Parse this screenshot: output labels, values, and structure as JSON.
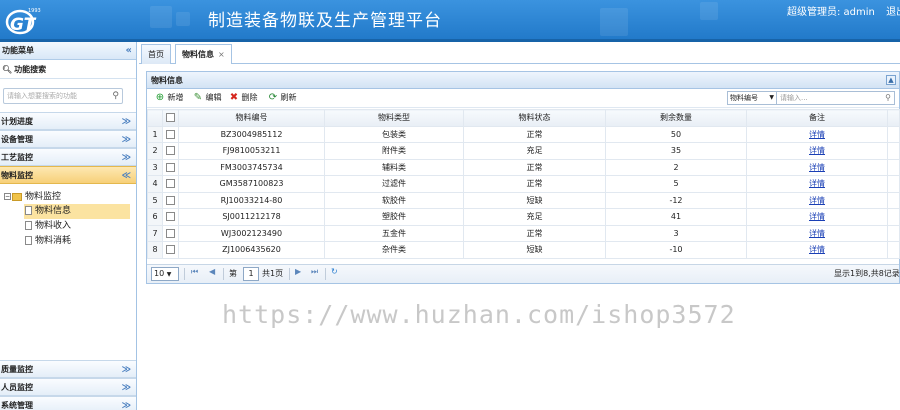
{
  "header": {
    "title": "制造装备物联及生产管理平台",
    "user_label": "超级管理员: admin",
    "logout": "退出",
    "logo_small": "1993",
    "logo_text": "GT"
  },
  "sidebar": {
    "title": "功能菜单",
    "collapse": "«",
    "search_title": "功能搜索",
    "search_placeholder": "请输入想要搜索的功能",
    "sections": [
      {
        "label": "计划进度",
        "chev": "≫"
      },
      {
        "label": "设备管理",
        "chev": "≫"
      },
      {
        "label": "工艺监控",
        "chev": "≫"
      },
      {
        "label": "物料监控",
        "chev": "≪"
      },
      {
        "label": "质量监控",
        "chev": "≫"
      },
      {
        "label": "人员监控",
        "chev": "≫"
      },
      {
        "label": "系统管理",
        "chev": "≫"
      }
    ],
    "tree": {
      "root": "物料监控",
      "items": [
        {
          "label": "物料信息"
        },
        {
          "label": "物料收入"
        },
        {
          "label": "物料消耗"
        }
      ]
    }
  },
  "tabs": [
    {
      "label": "首页"
    },
    {
      "label": "物料信息",
      "close": "×"
    }
  ],
  "panel": {
    "title": "物料信息",
    "collapse_icon": "▲"
  },
  "toolbar": {
    "add": "新增",
    "edit": "编辑",
    "delete": "删除",
    "refresh": "刷新",
    "search_field": "物料编号",
    "search_placeholder": "请输入..."
  },
  "table": {
    "headers": [
      "物料编号",
      "物料类型",
      "物料状态",
      "剩余数量",
      "备注"
    ],
    "rows": [
      {
        "n": "1",
        "code": "BZ3004985112",
        "type": "包装类",
        "status": "正常",
        "qty": "50",
        "note": "详情"
      },
      {
        "n": "2",
        "code": "FJ9810053211",
        "type": "附件类",
        "status": "充足",
        "qty": "35",
        "note": "详情"
      },
      {
        "n": "3",
        "code": "FM3003745734",
        "type": "辅料类",
        "status": "正常",
        "qty": "2",
        "note": "详情"
      },
      {
        "n": "4",
        "code": "GM3587100823",
        "type": "过滤件",
        "status": "正常",
        "qty": "5",
        "note": "详情"
      },
      {
        "n": "5",
        "code": "RJ10033214-80",
        "type": "软胶件",
        "status": "短缺",
        "qty": "-12",
        "note": "详情"
      },
      {
        "n": "6",
        "code": "SJ0011212178",
        "type": "塑胶件",
        "status": "充足",
        "qty": "41",
        "note": "详情"
      },
      {
        "n": "7",
        "code": "WJ3002123490",
        "type": "五金件",
        "status": "正常",
        "qty": "3",
        "note": "详情"
      },
      {
        "n": "8",
        "code": "ZJ1006435620",
        "type": "杂件类",
        "status": "短缺",
        "qty": "-10",
        "note": "详情"
      }
    ]
  },
  "pager": {
    "page_size": "10",
    "page_prefix": "第",
    "page_value": "1",
    "page_total": "共1页",
    "summary": "显示1到8,共8记录"
  },
  "watermark": "https://www.huzhan.com/ishop3572"
}
